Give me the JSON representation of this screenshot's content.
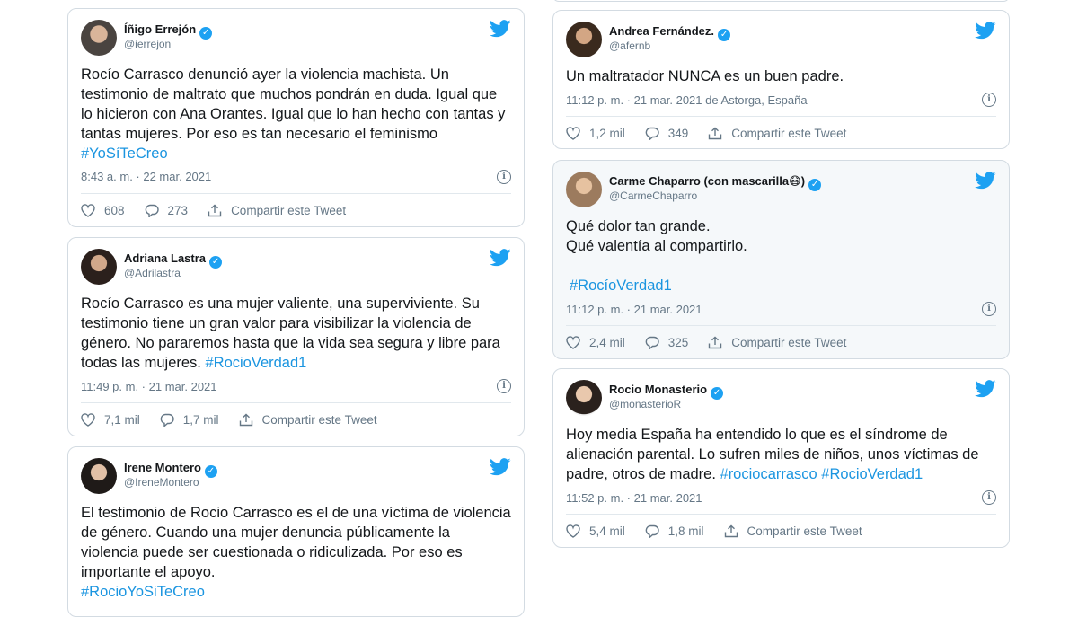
{
  "share_label": "Compartir este Tweet",
  "tweets": [
    {
      "name": "Íñigo Errejón",
      "handle": "@ierrejon",
      "text": "Rocío Carrasco denunció ayer la violencia machista. Un testimonio de maltrato que muchos pondrán en duda. Igual que lo hicieron con Ana Orantes. Igual que lo han hecho con tantas y tantas mujeres. Por eso es tan necesario el feminismo ",
      "hashtag": "#YoSíTeCreo",
      "meta": "8:43 a. m. · 22 mar. 2021",
      "likes": "608",
      "replies": "273"
    },
    {
      "name": "Adriana Lastra",
      "handle": "@Adrilastra",
      "text": "Rocío Carrasco es una mujer valiente, una superviviente. Su testimonio tiene un gran valor para visibilizar la violencia de género. No pararemos hasta que la vida sea segura y libre para todas las mujeres. ",
      "hashtag": "#RocioVerdad1",
      "meta": "11:49 p. m. · 21 mar. 2021",
      "likes": "7,1 mil",
      "replies": "1,7 mil"
    },
    {
      "name": "Irene Montero",
      "handle": "@IreneMontero",
      "text": "El testimonio de Rocio Carrasco es el de una víctima de violencia de género. Cuando una mujer denuncia públicamente la violencia puede ser cuestionada o ridiculizada. Por eso es importante el apoyo.\n",
      "hashtag": "#RocioYoSiTeCreo"
    },
    {
      "name": "Andrea Fernández.",
      "handle": "@afernb",
      "text": "Un maltratador NUNCA es un buen padre.",
      "hashtag": "",
      "meta": "11:12 p. m. · 21 mar. 2021 de Astorga, España",
      "likes": "1,2 mil",
      "replies": "349"
    },
    {
      "name": "Carme Chaparro (con mascarilla😷)",
      "handle": "@CarmeChaparro",
      "text": "Qué dolor tan grande.\nQué valentía al compartirlo.\n\n",
      "hashtag": "#RocíoVerdad1",
      "meta": "11:12 p. m. · 21 mar. 2021",
      "likes": "2,4 mil",
      "replies": "325"
    },
    {
      "name": "Rocio Monasterio",
      "handle": "@monasterioR",
      "text": "Hoy media España ha entendido lo que es el síndrome de alienación parental. Lo sufren miles de niños, unos víctimas de padre, otros de madre. ",
      "hashtag": "#rociocarrasco #RocioVerdad1",
      "meta": "11:52 p. m. · 21 mar. 2021",
      "likes": "5,4 mil",
      "replies": "1,8 mil"
    }
  ]
}
